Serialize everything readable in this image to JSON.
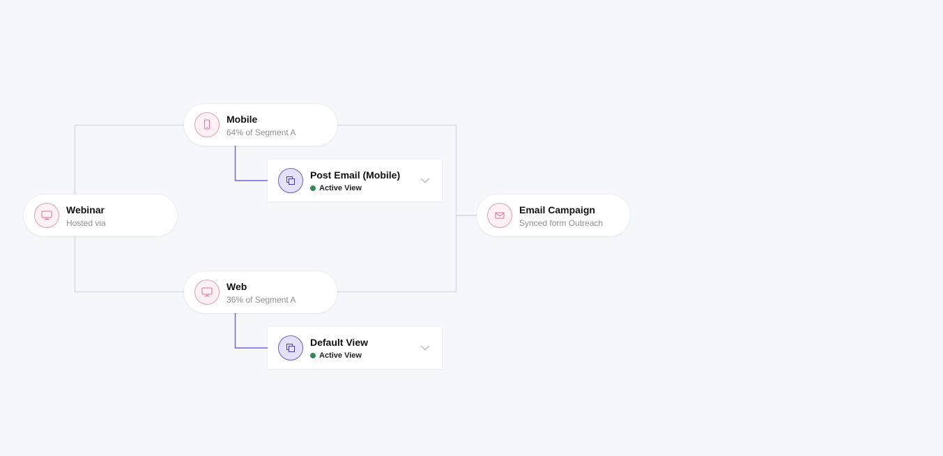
{
  "nodes": {
    "webinar": {
      "title": "Webinar",
      "subtitle": "Hosted via",
      "icon": "monitor-icon"
    },
    "mobile": {
      "title": "Mobile",
      "subtitle": "64% of Segment A",
      "icon": "smartphone-icon"
    },
    "web": {
      "title": "Web",
      "subtitle": "36% of Segment A",
      "icon": "monitor-icon"
    },
    "email_campaign": {
      "title": "Email Campaign",
      "subtitle": "Synced form Outreach",
      "icon": "mail-icon"
    }
  },
  "views": {
    "post_email_mobile": {
      "title": "Post Email (Mobile)",
      "status": "Active View",
      "icon": "copy-icon"
    },
    "default_view": {
      "title": "Default View",
      "status": "Active View",
      "icon": "copy-icon"
    }
  },
  "colors": {
    "background": "#f6f7fb",
    "connector": "#d8dae3",
    "branch_connector": "#7b61d9",
    "pill_icon_border": "#e79bb8",
    "view_icon_border": "#6a5acd",
    "status_active": "#2e8b57"
  }
}
